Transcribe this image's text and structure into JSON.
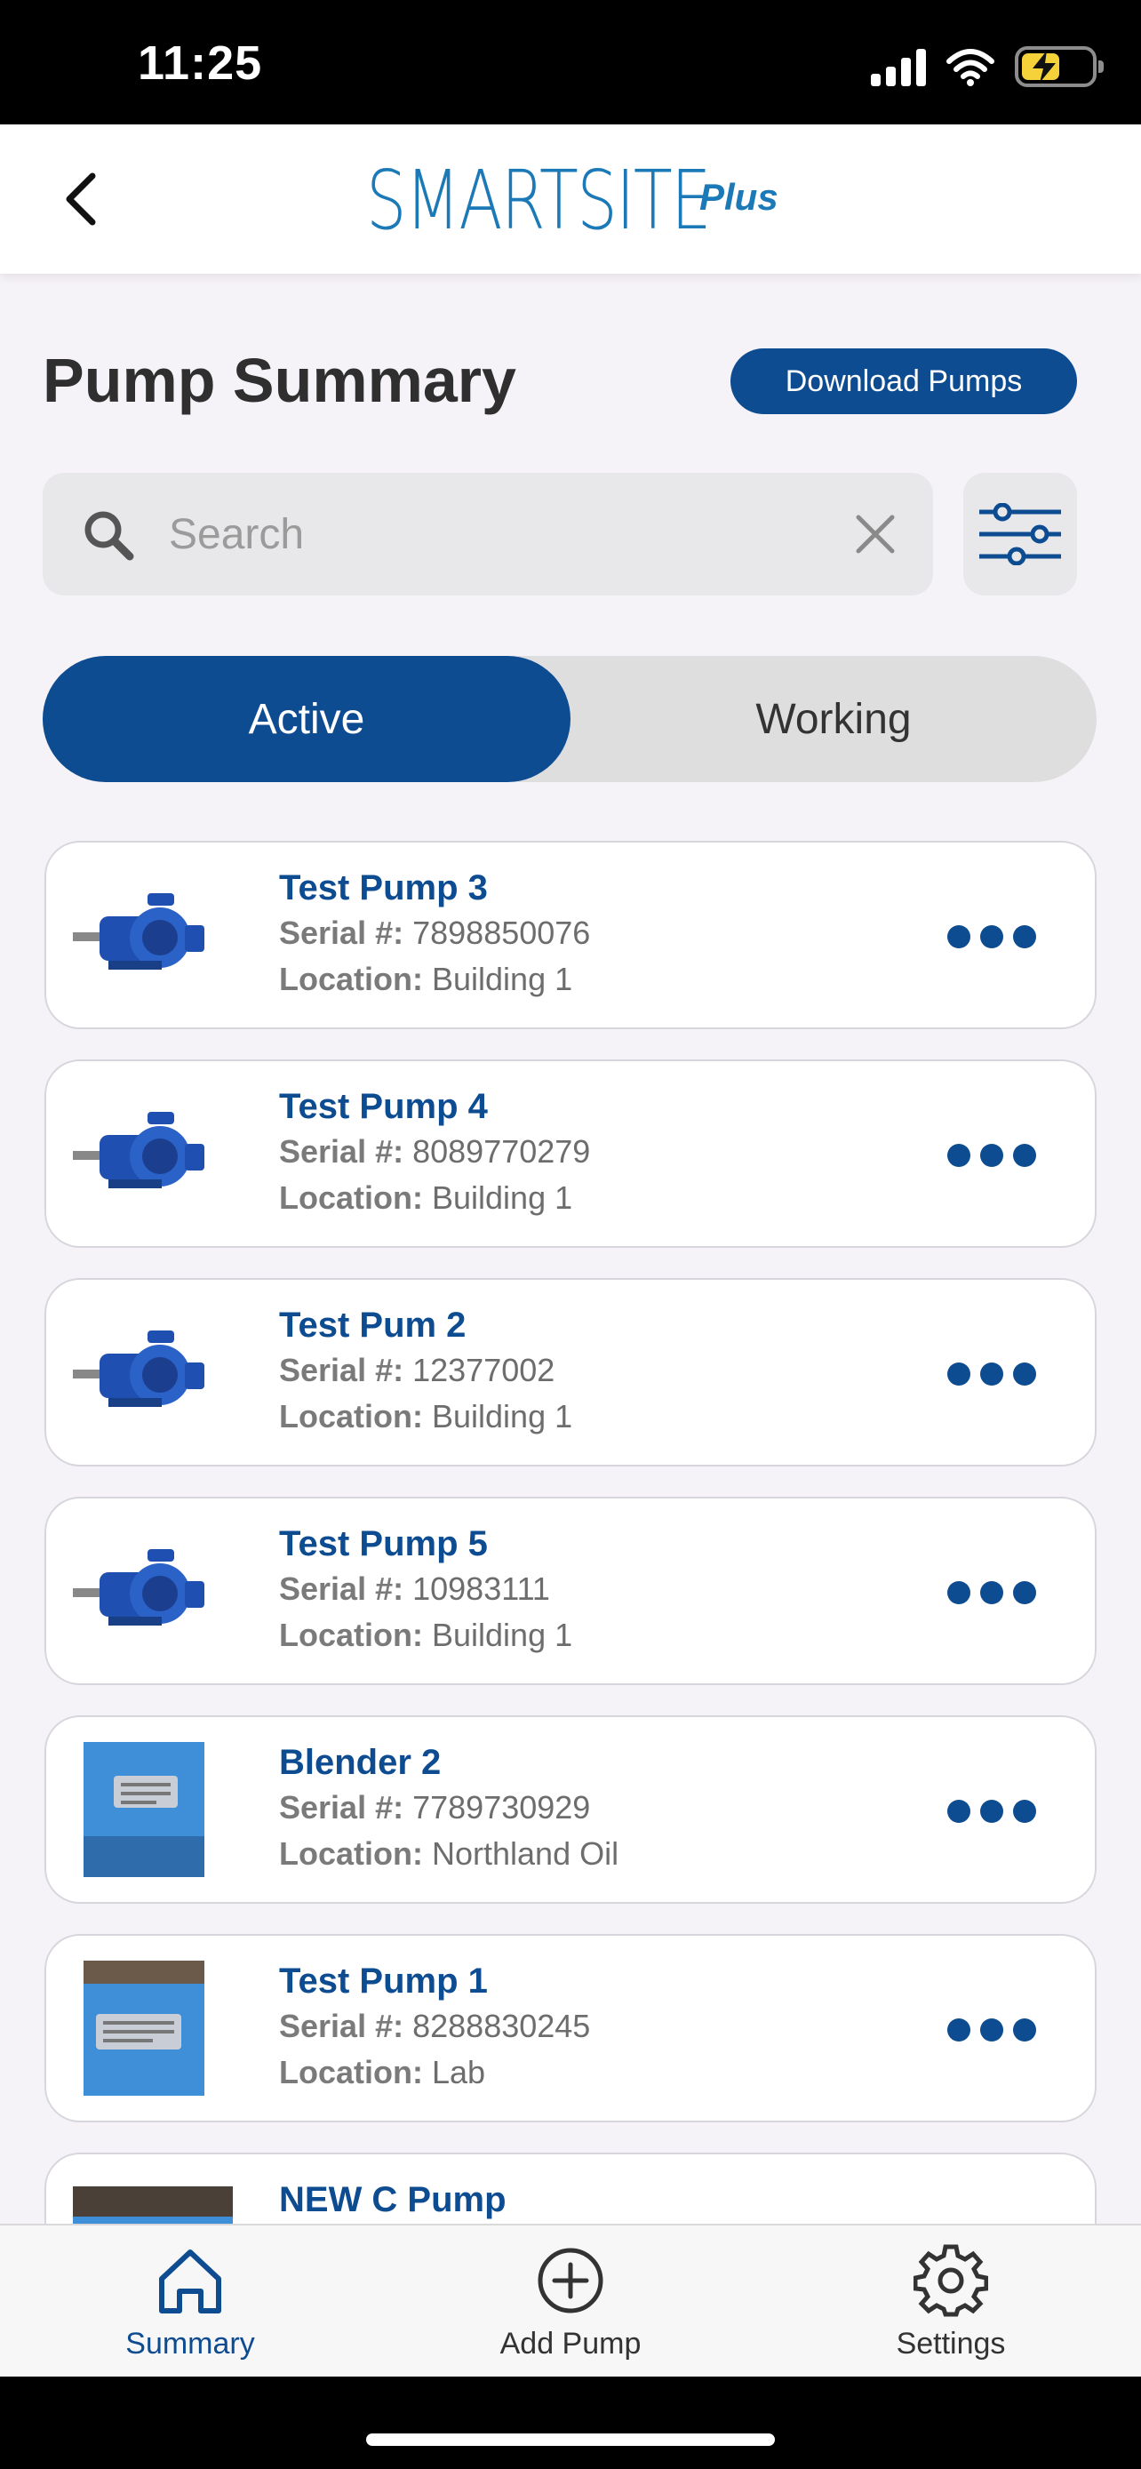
{
  "status_bar": {
    "time": "11:25"
  },
  "header": {
    "logo_text": "SMARTSITE",
    "logo_plus": "Plus"
  },
  "page": {
    "title": "Pump Summary",
    "download_label": "Download Pumps"
  },
  "search": {
    "placeholder": "Search",
    "value": ""
  },
  "tabs": [
    {
      "label": "Active",
      "selected": true
    },
    {
      "label": "Working",
      "selected": false
    }
  ],
  "pumps": [
    {
      "name": "Test Pump 3",
      "serial_label": "Serial #:",
      "serial": "7898850076",
      "location_label": "Location:",
      "location": "Building 1",
      "thumb": "blue-pump-icon"
    },
    {
      "name": "Test Pump 4",
      "serial_label": "Serial #:",
      "serial": "8089770279",
      "location_label": "Location:",
      "location": "Building 1",
      "thumb": "blue-pump-icon"
    },
    {
      "name": "Test Pum 2",
      "serial_label": "Serial #:",
      "serial": "12377002",
      "location_label": "Location:",
      "location": "Building 1",
      "thumb": "blue-pump-icon"
    },
    {
      "name": "Test Pump 5",
      "serial_label": "Serial #:",
      "serial": "10983111",
      "location_label": "Location:",
      "location": "Building 1",
      "thumb": "blue-pump-icon"
    },
    {
      "name": "Blender 2",
      "serial_label": "Serial #:",
      "serial": "7789730929",
      "location_label": "Location:",
      "location": "Northland Oil",
      "thumb": "nameplate-photo"
    },
    {
      "name": "Test Pump 1",
      "serial_label": "Serial #:",
      "serial": "8288830245",
      "location_label": "Location:",
      "location": "Lab",
      "thumb": "nameplate-photo"
    },
    {
      "name": "NEW C Pump",
      "serial_label": "",
      "serial": "",
      "location_label": "",
      "location": "",
      "thumb": "pump-photo"
    }
  ],
  "nav": [
    {
      "label": "Summary",
      "icon": "home-icon",
      "active": true
    },
    {
      "label": "Add Pump",
      "icon": "plus-circle-icon",
      "active": false
    },
    {
      "label": "Settings",
      "icon": "gear-icon",
      "active": false
    }
  ],
  "colors": {
    "primary": "#0e4c92",
    "logo": "#1b79b7",
    "background": "#f6f3f8"
  }
}
